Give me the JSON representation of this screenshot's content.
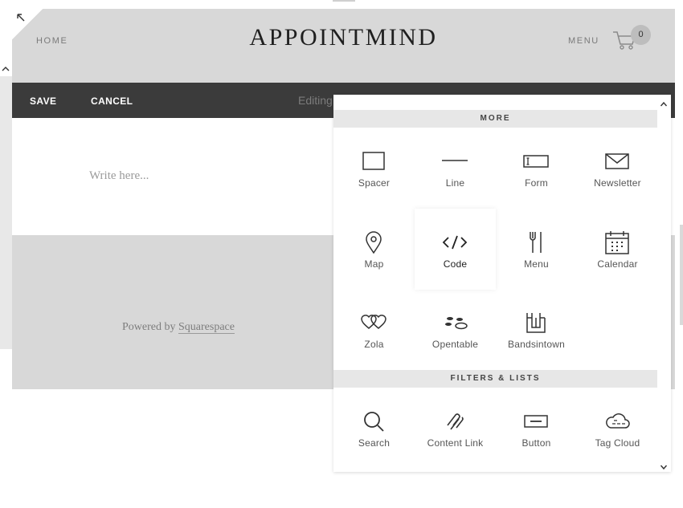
{
  "site": {
    "title": "APPOINTMIND",
    "nav_home": "HOME",
    "nav_menu": "MENU",
    "cart_count": "0"
  },
  "edit_bar": {
    "save_label": "SAVE",
    "cancel_label": "CANCEL",
    "status": "Editing"
  },
  "content": {
    "placeholder": "Write here...",
    "powered_prefix": "Powered by ",
    "powered_link": "Squarespace"
  },
  "panel": {
    "sections": [
      {
        "title": "MORE",
        "blocks": [
          {
            "label": "Spacer",
            "icon": "spacer-icon"
          },
          {
            "label": "Line",
            "icon": "line-icon"
          },
          {
            "label": "Form",
            "icon": "form-icon"
          },
          {
            "label": "Newsletter",
            "icon": "newsletter-icon"
          },
          {
            "label": "Map",
            "icon": "map-pin-icon"
          },
          {
            "label": "Code",
            "icon": "code-icon"
          },
          {
            "label": "Menu",
            "icon": "fork-knife-icon"
          },
          {
            "label": "Calendar",
            "icon": "calendar-icon"
          },
          {
            "label": "Zola",
            "icon": "zola-icon"
          },
          {
            "label": "Opentable",
            "icon": "opentable-icon"
          },
          {
            "label": "Bandsintown",
            "icon": "bandsintown-icon"
          }
        ]
      },
      {
        "title": "FILTERS & LISTS",
        "blocks": [
          {
            "label": "Search",
            "icon": "search-icon"
          },
          {
            "label": "Content Link",
            "icon": "content-link-icon"
          },
          {
            "label": "Button",
            "icon": "button-icon"
          },
          {
            "label": "Tag Cloud",
            "icon": "tag-cloud-icon"
          }
        ]
      }
    ]
  },
  "colors": {
    "header_bg": "#d8d8d8",
    "edit_bar_bg": "#3b3b3b",
    "section_header_bg": "#e7e7e7",
    "icon_stroke": "#333333"
  }
}
